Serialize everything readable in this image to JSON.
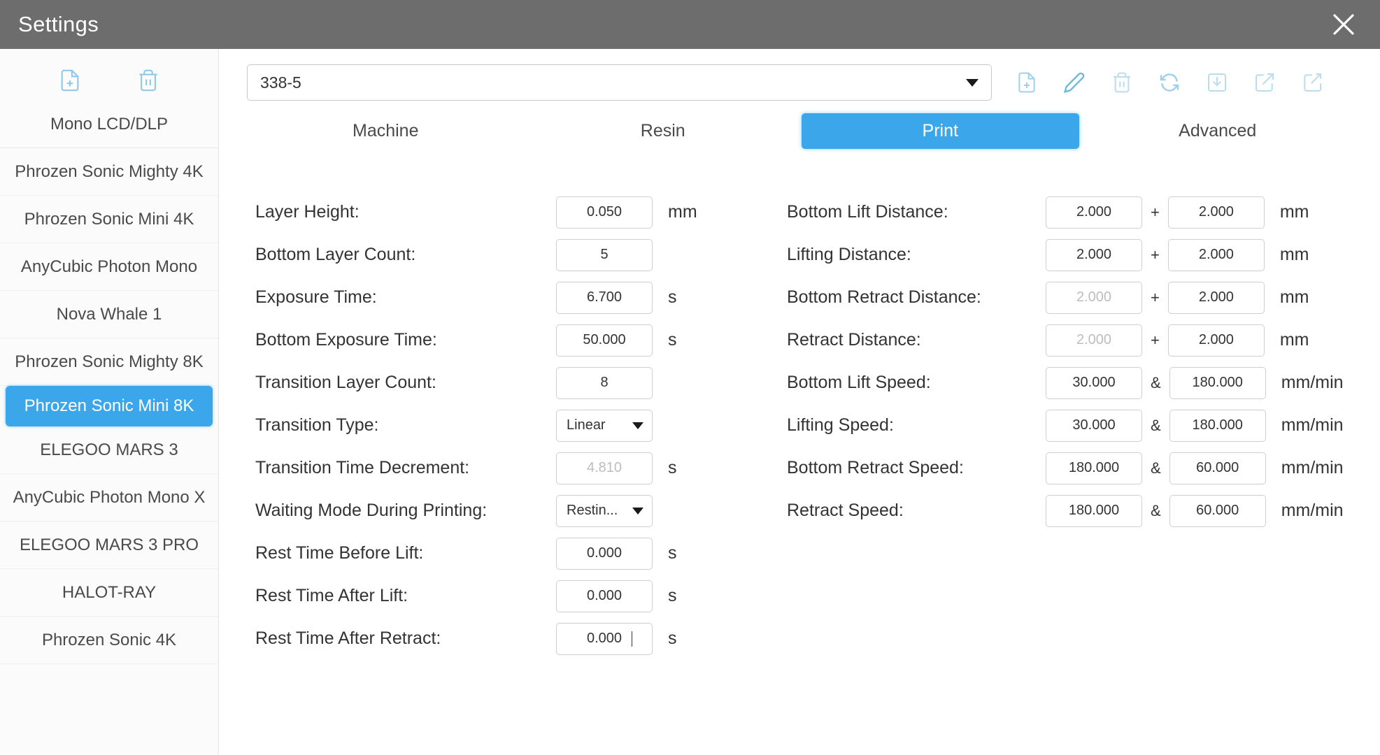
{
  "window": {
    "title": "Settings",
    "close_icon": "close-icon"
  },
  "sidebar": {
    "tools": [
      {
        "icon": "new-file-icon",
        "name": "add-printer"
      },
      {
        "icon": "trash-icon",
        "name": "delete-printer"
      }
    ],
    "header": "Mono LCD/DLP",
    "items": [
      {
        "label": "Phrozen Sonic Mighty 4K",
        "selected": false
      },
      {
        "label": "Phrozen Sonic Mini 4K",
        "selected": false
      },
      {
        "label": "AnyCubic Photon Mono",
        "selected": false
      },
      {
        "label": "Nova Whale 1",
        "selected": false
      },
      {
        "label": "Phrozen Sonic Mighty 8K",
        "selected": false
      },
      {
        "label": "Phrozen Sonic Mini 8K",
        "selected": true
      },
      {
        "label": "ELEGOO MARS 3",
        "selected": false
      },
      {
        "label": "AnyCubic Photon Mono X",
        "selected": false
      },
      {
        "label": "ELEGOO MARS 3 PRO",
        "selected": false
      },
      {
        "label": "HALOT-RAY",
        "selected": false
      },
      {
        "label": "Phrozen Sonic 4K",
        "selected": false
      }
    ]
  },
  "toolbar": {
    "profile_value": "338-5",
    "icons": [
      {
        "name": "new-profile-icon"
      },
      {
        "name": "edit-profile-icon"
      },
      {
        "name": "delete-profile-icon"
      },
      {
        "name": "reset-profile-icon"
      },
      {
        "name": "import-profile-icon"
      },
      {
        "name": "export-profile-icon"
      },
      {
        "name": "share-profile-icon"
      }
    ]
  },
  "tabs": [
    {
      "label": "Machine",
      "active": false
    },
    {
      "label": "Resin",
      "active": false
    },
    {
      "label": "Print",
      "active": true
    },
    {
      "label": "Advanced",
      "active": false
    }
  ],
  "accent_color": "#3ba7ea",
  "form": {
    "left": [
      {
        "label": "Layer Height:",
        "type": "input",
        "value": "0.050",
        "unit": "mm",
        "dim": false,
        "caret": false
      },
      {
        "label": "Bottom Layer Count:",
        "type": "input",
        "value": "5",
        "unit": "",
        "dim": false,
        "caret": false
      },
      {
        "label": "Exposure Time:",
        "type": "input",
        "value": "6.700",
        "unit": "s",
        "dim": false,
        "caret": false
      },
      {
        "label": "Bottom Exposure Time:",
        "type": "input",
        "value": "50.000",
        "unit": "s",
        "dim": false,
        "caret": false
      },
      {
        "label": "Transition Layer Count:",
        "type": "input",
        "value": "8",
        "unit": "",
        "dim": false,
        "caret": false
      },
      {
        "label": "Transition Type:",
        "type": "select",
        "value": "Linear",
        "unit": "",
        "dim": false,
        "caret": false
      },
      {
        "label": "Transition Time Decrement:",
        "type": "input",
        "value": "4.810",
        "unit": "s",
        "dim": true,
        "caret": false
      },
      {
        "label": "Waiting Mode During Printing:",
        "type": "select",
        "value": "Restin...",
        "unit": "",
        "dim": false,
        "caret": false
      },
      {
        "label": "Rest Time Before Lift:",
        "type": "input",
        "value": "0.000",
        "unit": "s",
        "dim": false,
        "caret": false
      },
      {
        "label": "Rest Time After Lift:",
        "type": "input",
        "value": "0.000",
        "unit": "s",
        "dim": false,
        "caret": false
      },
      {
        "label": "Rest Time After Retract:",
        "type": "input",
        "value": "0.000",
        "unit": "s",
        "dim": false,
        "caret": true
      }
    ],
    "right": [
      {
        "label": "Bottom Lift Distance:",
        "value1": "2.000",
        "sep": "+",
        "value2": "2.000",
        "unit": "mm",
        "dim1": false
      },
      {
        "label": "Lifting Distance:",
        "value1": "2.000",
        "sep": "+",
        "value2": "2.000",
        "unit": "mm",
        "dim1": false
      },
      {
        "label": "Bottom Retract Distance:",
        "value1": "2.000",
        "sep": "+",
        "value2": "2.000",
        "unit": "mm",
        "dim1": true
      },
      {
        "label": "Retract Distance:",
        "value1": "2.000",
        "sep": "+",
        "value2": "2.000",
        "unit": "mm",
        "dim1": true
      },
      {
        "label": "Bottom Lift Speed:",
        "value1": "30.000",
        "sep": "&",
        "value2": "180.000",
        "unit": "mm/min",
        "dim1": false
      },
      {
        "label": "Lifting Speed:",
        "value1": "30.000",
        "sep": "&",
        "value2": "180.000",
        "unit": "mm/min",
        "dim1": false
      },
      {
        "label": "Bottom Retract Speed:",
        "value1": "180.000",
        "sep": "&",
        "value2": "60.000",
        "unit": "mm/min",
        "dim1": false
      },
      {
        "label": "Retract Speed:",
        "value1": "180.000",
        "sep": "&",
        "value2": "60.000",
        "unit": "mm/min",
        "dim1": false
      }
    ]
  }
}
